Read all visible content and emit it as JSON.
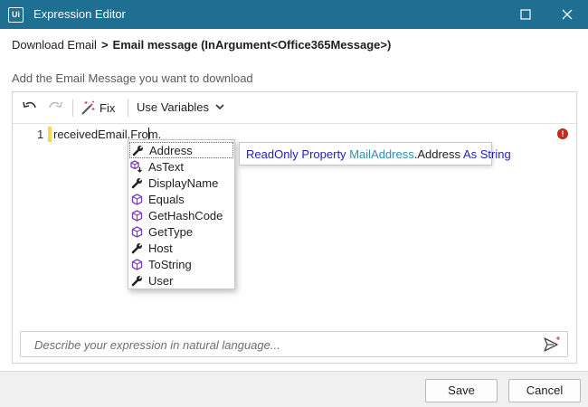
{
  "window": {
    "app_icon_text": "Ui",
    "title": "Expression Editor"
  },
  "breadcrumb": {
    "parent": "Download Email",
    "separator": ">",
    "current": "Email message (InArgument<Office365Message>)"
  },
  "hint": "Add the Email Message you want to download",
  "toolbar": {
    "undo_icon": "undo-icon",
    "redo_icon": "redo-icon",
    "fix_icon": "magic-wand-icon",
    "fix_label": "Fix",
    "variables_label": "Use Variables"
  },
  "editor": {
    "line_number": "1",
    "code": "receivedEmail.From."
  },
  "completion": {
    "items": [
      {
        "label": "Address",
        "icon": "wrench-icon",
        "selected": true
      },
      {
        "label": "AsText",
        "icon": "extension-method-icon"
      },
      {
        "label": "DisplayName",
        "icon": "wrench-icon"
      },
      {
        "label": "Equals",
        "icon": "method-cube-icon"
      },
      {
        "label": "GetHashCode",
        "icon": "method-cube-icon"
      },
      {
        "label": "GetType",
        "icon": "method-cube-icon"
      },
      {
        "label": "Host",
        "icon": "wrench-icon"
      },
      {
        "label": "ToString",
        "icon": "method-cube-icon"
      },
      {
        "label": "User",
        "icon": "wrench-icon"
      }
    ]
  },
  "tooltip": {
    "kw1": "ReadOnly Property",
    "type1": "MailAddress",
    "member": ".Address",
    "kw2": "As String"
  },
  "nl_input": {
    "placeholder": "Describe your expression in natural language..."
  },
  "footer": {
    "save_label": "Save",
    "cancel_label": "Cancel"
  },
  "colors": {
    "titlebar": "#1f6f93",
    "keyword": "#1e1ebd",
    "type": "#2b91af",
    "error": "#c42b1c",
    "method_icon": "#7a3db8"
  }
}
